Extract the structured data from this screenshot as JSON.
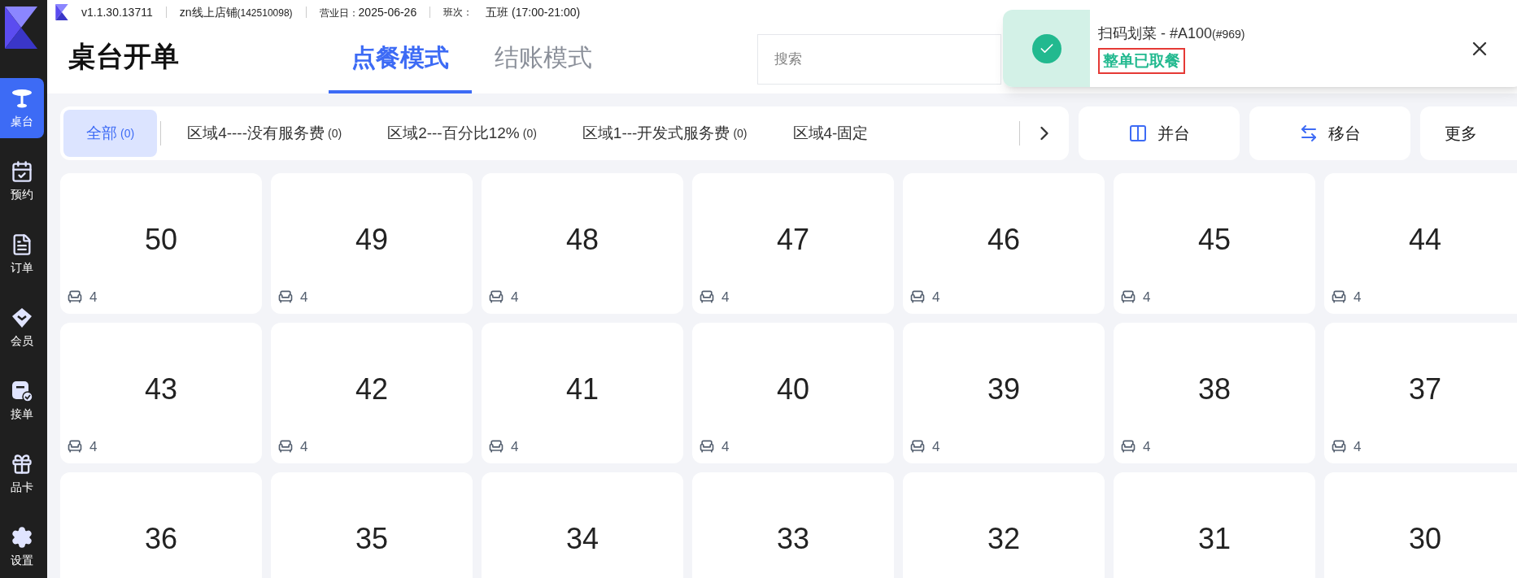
{
  "top_bar": {
    "version": "v1.1.30.13711",
    "store": "zn线上店铺",
    "store_id": "(142510098)",
    "business_day_label": "营业日：",
    "business_day": "2025-06-26",
    "shift_label": "班次：",
    "shift": "五班 (17:00-21:00)"
  },
  "sidebar": {
    "items": [
      {
        "label": "桌台",
        "kind": "table",
        "selected": true
      },
      {
        "label": "预约",
        "kind": "reserve",
        "selected": false
      },
      {
        "label": "订单",
        "kind": "order",
        "selected": false
      },
      {
        "label": "会员",
        "kind": "member",
        "selected": false
      },
      {
        "label": "接单",
        "kind": "accept",
        "selected": false
      },
      {
        "label": "品卡",
        "kind": "gift",
        "selected": false
      },
      {
        "label": "设置",
        "kind": "settings",
        "selected": false
      }
    ]
  },
  "header": {
    "title": "桌台开单",
    "tabs": [
      {
        "label": "点餐模式",
        "selected": true
      },
      {
        "label": "结账模式",
        "selected": false
      }
    ],
    "search": {
      "placeholder": "搜索"
    }
  },
  "toast": {
    "title": "扫码划菜 - #A100",
    "ref": "(#969)",
    "status": "整单已取餐",
    "highlighted": true
  },
  "areas": [
    {
      "label": "全部",
      "count": "(0)",
      "selected": true
    },
    {
      "label": "区域4----没有服务费",
      "count": "(0)",
      "selected": false
    },
    {
      "label": "区域2---百分比12%",
      "count": "(0)",
      "selected": false
    },
    {
      "label": "区域1---开发式服务费",
      "count": "(0)",
      "selected": false
    },
    {
      "label": "区域4-固定",
      "selected": false
    }
  ],
  "actions": [
    {
      "label": "并台",
      "kind": "merge"
    },
    {
      "label": "移台",
      "kind": "move"
    },
    {
      "label": "更多",
      "kind": "more"
    }
  ],
  "tables": [
    {
      "number": "50",
      "seats": "4"
    },
    {
      "number": "49",
      "seats": "4"
    },
    {
      "number": "48",
      "seats": "4"
    },
    {
      "number": "47",
      "seats": "4"
    },
    {
      "number": "46",
      "seats": "4"
    },
    {
      "number": "45",
      "seats": "4"
    },
    {
      "number": "44",
      "seats": "4"
    },
    {
      "number": "43",
      "seats": "4"
    },
    {
      "number": "42",
      "seats": "4"
    },
    {
      "number": "41",
      "seats": "4"
    },
    {
      "number": "40",
      "seats": "4"
    },
    {
      "number": "39",
      "seats": "4"
    },
    {
      "number": "38",
      "seats": "4"
    },
    {
      "number": "37",
      "seats": "4"
    },
    {
      "number": "36"
    },
    {
      "number": "35"
    },
    {
      "number": "34"
    },
    {
      "number": "33"
    },
    {
      "number": "32"
    },
    {
      "number": "31"
    },
    {
      "number": "30"
    }
  ]
}
